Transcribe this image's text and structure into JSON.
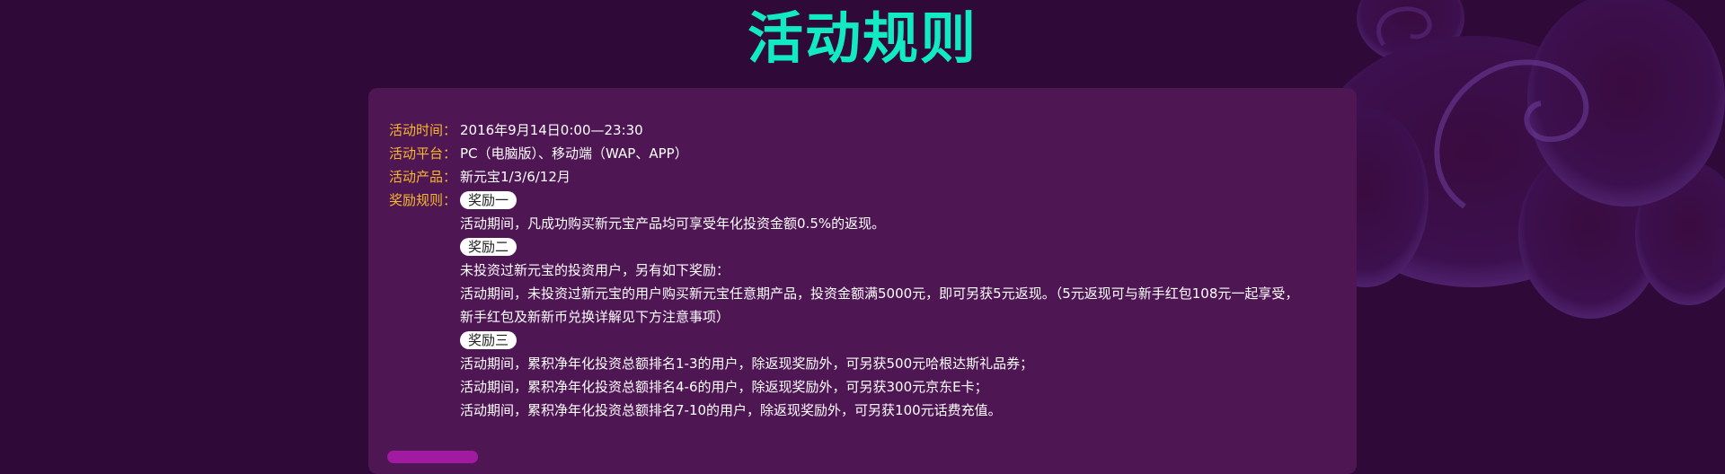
{
  "colors": {
    "background": "#2f0a38",
    "panel": "#4f1654",
    "title": "#12eac4",
    "label": "#f5b82e",
    "text": "#ffffff"
  },
  "title": "活动规则",
  "rules": {
    "time": {
      "label": "活动时间：",
      "value": "2016年9月14日0:00—23:30"
    },
    "platform": {
      "label": "活动平台：",
      "value": "PC（电脑版）、移动端（WAP、APP）"
    },
    "product": {
      "label": "活动产品：",
      "value": "新元宝1/3/6/12月"
    },
    "reward": {
      "label": "奖励规则："
    }
  },
  "rewards": [
    {
      "badge": "奖励一",
      "lines": [
        "活动期间，凡成功购买新元宝产品均可享受年化投资金额0.5%的返现。"
      ]
    },
    {
      "badge": "奖励二",
      "lines": [
        "未投资过新元宝的投资用户，另有如下奖励：",
        "活动期间，未投资过新元宝的用户购买新元宝任意期产品，投资金额满5000元，即可另获5元返现。（5元返现可与新手红包108元一起享受，",
        "新手红包及新新币兑换详解见下方注意事项）"
      ]
    },
    {
      "badge": "奖励三",
      "lines": [
        "活动期间，累积净年化投资总额排名1-3的用户，除返现奖励外，可另获500元哈根达斯礼品券；",
        "活动期间，累积净年化投资总额排名4-6的用户，除返现奖励外，可另获300元京东E卡；",
        "活动期间，累积净年化投资总额排名7-10的用户，除返现奖励外，可另获100元话费充值。"
      ]
    }
  ]
}
